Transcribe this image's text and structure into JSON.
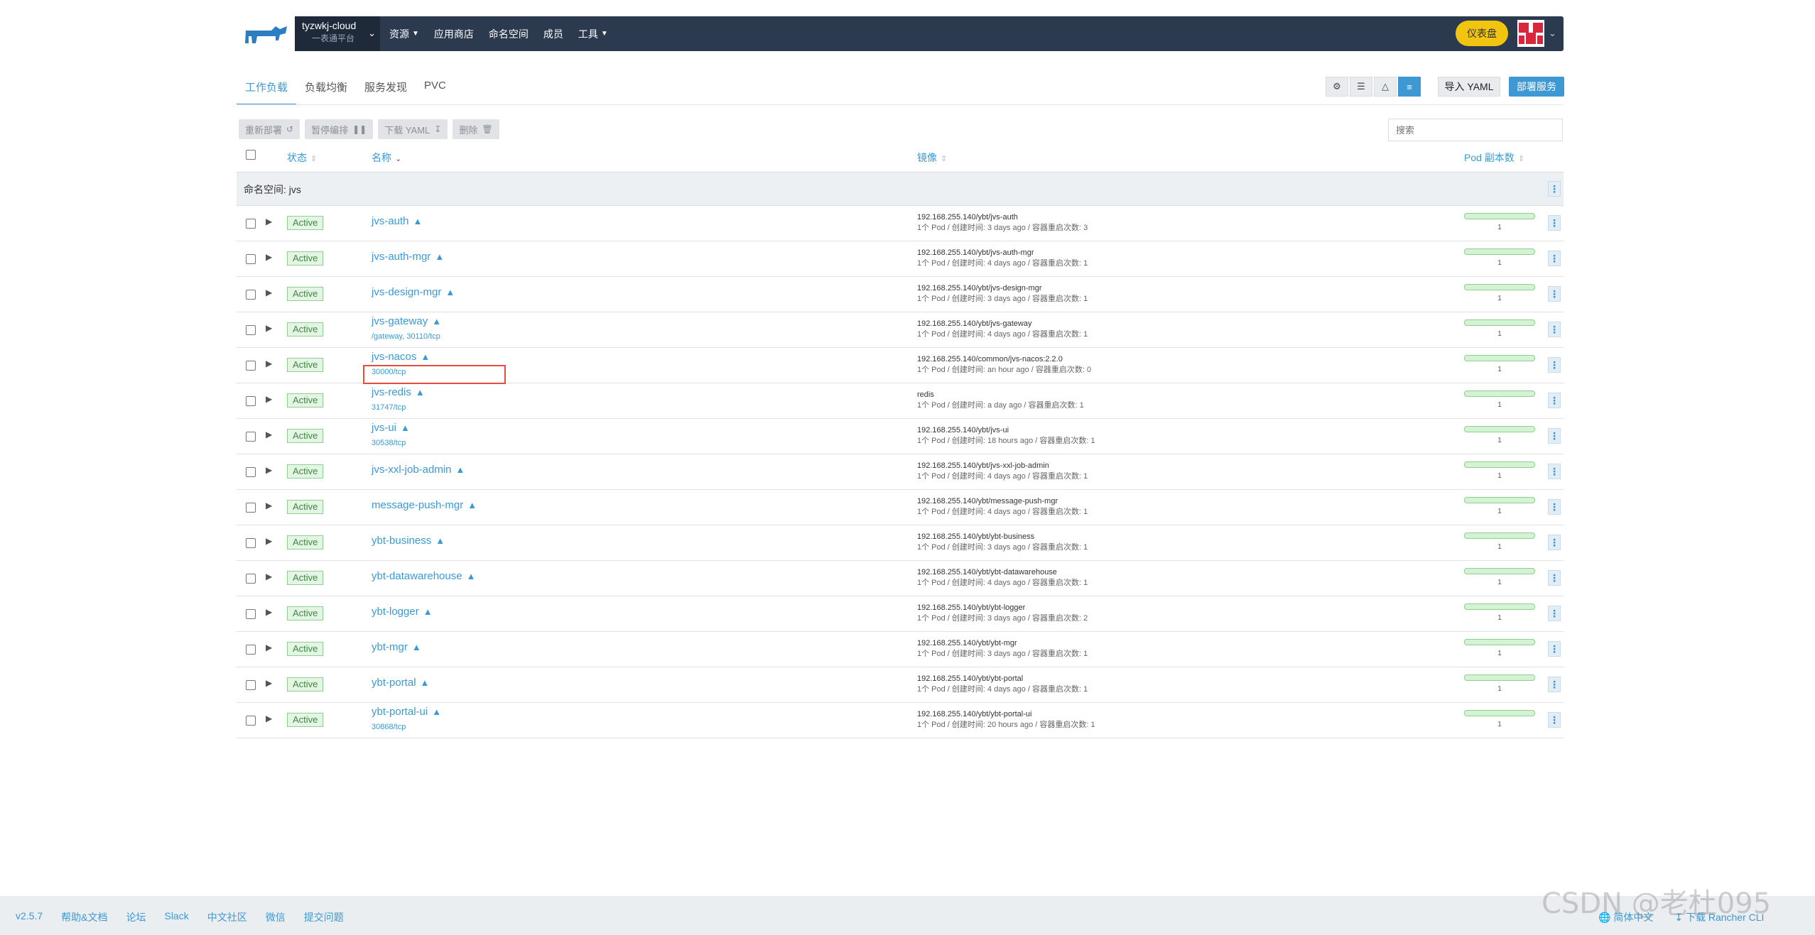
{
  "header": {
    "cluster_name": "tyzwkj-cloud",
    "cluster_sub": "一表通平台",
    "nav": [
      {
        "label": "资源",
        "caret": true
      },
      {
        "label": "应用商店",
        "caret": false
      },
      {
        "label": "命名空间",
        "caret": false
      },
      {
        "label": "成员",
        "caret": false
      },
      {
        "label": "工具",
        "caret": true
      }
    ],
    "dashboard_label": "仪表盘"
  },
  "tabs": [
    "工作负载",
    "负载均衡",
    "服务发现",
    "PVC"
  ],
  "toolbar": {
    "import_yaml": "导入 YAML",
    "deploy": "部署服务"
  },
  "actions": {
    "redeploy": "重新部署",
    "pause": "暂停编排",
    "download_yaml": "下载 YAML",
    "delete": "删除"
  },
  "search": {
    "placeholder": "搜索"
  },
  "columns": {
    "status": "状态",
    "name": "名称",
    "image": "镜像",
    "pods": "Pod 副本数"
  },
  "namespace_label": "命名空间: jvs",
  "workloads": [
    {
      "status": "Active",
      "name": "jvs-auth",
      "port": "",
      "image": "192.168.255.140/ybt/jvs-auth",
      "meta": "1个 Pod / 创建时间: 3 days ago / 容器重启次数: 3",
      "pods": "1"
    },
    {
      "status": "Active",
      "name": "jvs-auth-mgr",
      "port": "",
      "image": "192.168.255.140/ybt/jvs-auth-mgr",
      "meta": "1个 Pod / 创建时间: 4 days ago / 容器重启次数: 1",
      "pods": "1"
    },
    {
      "status": "Active",
      "name": "jvs-design-mgr",
      "port": "",
      "image": "192.168.255.140/ybt/jvs-design-mgr",
      "meta": "1个 Pod / 创建时间: 3 days ago / 容器重启次数: 1",
      "pods": "1"
    },
    {
      "status": "Active",
      "name": "jvs-gateway",
      "port": "/gateway, 30110/tcp",
      "image": "192.168.255.140/ybt/jvs-gateway",
      "meta": "1个 Pod / 创建时间: 4 days ago / 容器重启次数: 1",
      "pods": "1"
    },
    {
      "status": "Active",
      "name": "jvs-nacos",
      "port": "30000/tcp",
      "image": "192.168.255.140/common/jvs-nacos:2.2.0",
      "meta": "1个 Pod / 创建时间: an hour ago / 容器重启次数: 0",
      "pods": "1"
    },
    {
      "status": "Active",
      "name": "jvs-redis",
      "port": "31747/tcp",
      "image": "redis",
      "meta": "1个 Pod / 创建时间: a day ago / 容器重启次数: 1",
      "pods": "1"
    },
    {
      "status": "Active",
      "name": "jvs-ui",
      "port": "30538/tcp",
      "image": "192.168.255.140/ybt/jvs-ui",
      "meta": "1个 Pod / 创建时间: 18 hours ago / 容器重启次数: 1",
      "pods": "1"
    },
    {
      "status": "Active",
      "name": "jvs-xxl-job-admin",
      "port": "",
      "image": "192.168.255.140/ybt/jvs-xxl-job-admin",
      "meta": "1个 Pod / 创建时间: 4 days ago / 容器重启次数: 1",
      "pods": "1"
    },
    {
      "status": "Active",
      "name": "message-push-mgr",
      "port": "",
      "image": "192.168.255.140/ybt/message-push-mgr",
      "meta": "1个 Pod / 创建时间: 4 days ago / 容器重启次数: 1",
      "pods": "1"
    },
    {
      "status": "Active",
      "name": "ybt-business",
      "port": "",
      "image": "192.168.255.140/ybt/ybt-business",
      "meta": "1个 Pod / 创建时间: 3 days ago / 容器重启次数: 1",
      "pods": "1"
    },
    {
      "status": "Active",
      "name": "ybt-datawarehouse",
      "port": "",
      "image": "192.168.255.140/ybt/ybt-datawarehouse",
      "meta": "1个 Pod / 创建时间: 4 days ago / 容器重启次数: 1",
      "pods": "1"
    },
    {
      "status": "Active",
      "name": "ybt-logger",
      "port": "",
      "image": "192.168.255.140/ybt/ybt-logger",
      "meta": "1个 Pod / 创建时间: 3 days ago / 容器重启次数: 2",
      "pods": "1"
    },
    {
      "status": "Active",
      "name": "ybt-mgr",
      "port": "",
      "image": "192.168.255.140/ybt/ybt-mgr",
      "meta": "1个 Pod / 创建时间: 3 days ago / 容器重启次数: 1",
      "pods": "1"
    },
    {
      "status": "Active",
      "name": "ybt-portal",
      "port": "",
      "image": "192.168.255.140/ybt/ybt-portal",
      "meta": "1个 Pod / 创建时间: 4 days ago / 容器重启次数: 1",
      "pods": "1"
    },
    {
      "status": "Active",
      "name": "ybt-portal-ui",
      "port": "30868/tcp",
      "image": "192.168.255.140/ybt/ybt-portal-ui",
      "meta": "1个 Pod / 创建时间: 20 hours ago / 容器重启次数: 1",
      "pods": "1"
    }
  ],
  "footer": {
    "links": [
      "v2.5.7",
      "帮助&文档",
      "论坛",
      "Slack",
      "中文社区",
      "微信",
      "提交问题"
    ],
    "language": "简体中文",
    "download": "下载 Rancher CLI"
  },
  "watermark": "CSDN @老杜095",
  "colors": {
    "accent": "#3d98d3",
    "header_bg": "#2b3a4e",
    "dashboard": "#f1c40f",
    "status_green": "#3c8a3c",
    "highlight": "#e74c3c"
  }
}
